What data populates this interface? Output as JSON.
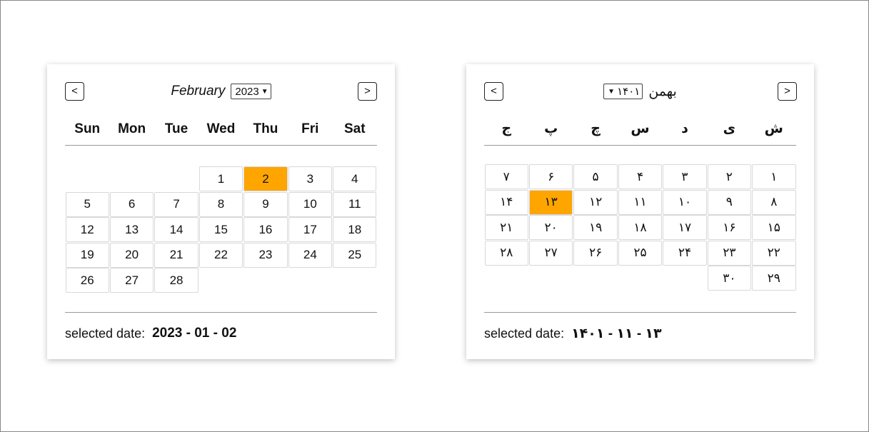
{
  "gregorian": {
    "prev_label": "<",
    "next_label": ">",
    "month": "February",
    "year": "2023",
    "weekdays": [
      "Sun",
      "Mon",
      "Tue",
      "Wed",
      "Thu",
      "Fri",
      "Sat"
    ],
    "days": [
      "1",
      "2",
      "3",
      "4",
      "5",
      "6",
      "7",
      "8",
      "9",
      "10",
      "11",
      "12",
      "13",
      "14",
      "15",
      "16",
      "17",
      "18",
      "19",
      "20",
      "21",
      "22",
      "23",
      "24",
      "25",
      "26",
      "27",
      "28"
    ],
    "selected_day": "2",
    "selected_label": "selected date:",
    "selected_value": "2023 - 01 - 02",
    "accent_color": "#ffa500"
  },
  "persian": {
    "prev_label": "<",
    "next_label": ">",
    "month": "بهمن",
    "year": "۱۴۰۱",
    "weekdays": [
      "ش",
      "ی",
      "د",
      "س",
      "چ",
      "پ",
      "ج"
    ],
    "days": [
      "۱",
      "۲",
      "۳",
      "۴",
      "۵",
      "۶",
      "۷",
      "۸",
      "۹",
      "۱۰",
      "۱۱",
      "۱۲",
      "۱۳",
      "۱۴",
      "۱۵",
      "۱۶",
      "۱۷",
      "۱۸",
      "۱۹",
      "۲۰",
      "۲۱",
      "۲۲",
      "۲۳",
      "۲۴",
      "۲۵",
      "۲۶",
      "۲۷",
      "۲۸",
      "۲۹",
      "۳۰"
    ],
    "selected_day": "۱۳",
    "selected_label": "selected date:",
    "selected_value": "۱۴۰۱ - ۱۱ - ۱۳",
    "accent_color": "#ffa500"
  }
}
